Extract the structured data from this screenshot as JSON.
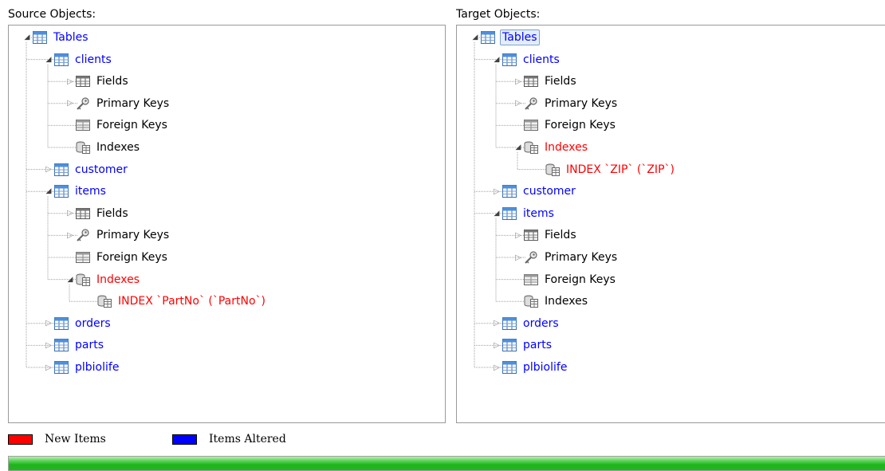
{
  "source": {
    "label": "Source Objects:",
    "rows": [
      {
        "text": "Tables",
        "color": "blue",
        "expander": "expanded",
        "icon": "table",
        "level": 0
      },
      {
        "text": "clients",
        "color": "blue",
        "expander": "expanded",
        "icon": "table",
        "level": 1
      },
      {
        "text": "Fields",
        "color": "black",
        "expander": "collapsed",
        "icon": "fields",
        "level": 2
      },
      {
        "text": "Primary Keys",
        "color": "black",
        "expander": "collapsed",
        "icon": "key",
        "level": 2
      },
      {
        "text": "Foreign Keys",
        "color": "black",
        "expander": "none",
        "icon": "fk",
        "level": 2
      },
      {
        "text": "Indexes",
        "color": "black",
        "expander": "none",
        "icon": "index",
        "level": 2
      },
      {
        "text": "customer",
        "color": "blue",
        "expander": "collapsed",
        "icon": "table",
        "level": 1
      },
      {
        "text": "items",
        "color": "blue",
        "expander": "expanded",
        "icon": "table",
        "level": 1
      },
      {
        "text": "Fields",
        "color": "black",
        "expander": "collapsed",
        "icon": "fields",
        "level": 2
      },
      {
        "text": "Primary Keys",
        "color": "black",
        "expander": "collapsed",
        "icon": "key",
        "level": 2
      },
      {
        "text": "Foreign Keys",
        "color": "black",
        "expander": "none",
        "icon": "fk",
        "level": 2
      },
      {
        "text": "Indexes",
        "color": "red",
        "expander": "expanded",
        "icon": "index",
        "level": 2
      },
      {
        "text": "INDEX `PartNo` (`PartNo`)",
        "color": "red",
        "expander": "none",
        "icon": "index",
        "level": 3
      },
      {
        "text": "orders",
        "color": "blue",
        "expander": "collapsed",
        "icon": "table",
        "level": 1
      },
      {
        "text": "parts",
        "color": "blue",
        "expander": "collapsed",
        "icon": "table",
        "level": 1
      },
      {
        "text": "plbiolife",
        "color": "blue",
        "expander": "collapsed",
        "icon": "table",
        "level": 1
      }
    ]
  },
  "target": {
    "label": "Target Objects:",
    "rows": [
      {
        "text": "Tables",
        "color": "blue",
        "expander": "expanded",
        "icon": "table",
        "level": 0,
        "selected": true
      },
      {
        "text": "clients",
        "color": "blue",
        "expander": "expanded",
        "icon": "table",
        "level": 1
      },
      {
        "text": "Fields",
        "color": "black",
        "expander": "collapsed",
        "icon": "fields",
        "level": 2
      },
      {
        "text": "Primary Keys",
        "color": "black",
        "expander": "collapsed",
        "icon": "key",
        "level": 2
      },
      {
        "text": "Foreign Keys",
        "color": "black",
        "expander": "none",
        "icon": "fk",
        "level": 2
      },
      {
        "text": "Indexes",
        "color": "red",
        "expander": "expanded",
        "icon": "index",
        "level": 2
      },
      {
        "text": "INDEX `ZIP` (`ZIP`)",
        "color": "red",
        "expander": "none",
        "icon": "index",
        "level": 3
      },
      {
        "text": "customer",
        "color": "blue",
        "expander": "collapsed",
        "icon": "table",
        "level": 1
      },
      {
        "text": "items",
        "color": "blue",
        "expander": "expanded",
        "icon": "table",
        "level": 1
      },
      {
        "text": "Fields",
        "color": "black",
        "expander": "collapsed",
        "icon": "fields",
        "level": 2
      },
      {
        "text": "Primary Keys",
        "color": "black",
        "expander": "collapsed",
        "icon": "key",
        "level": 2
      },
      {
        "text": "Foreign Keys",
        "color": "black",
        "expander": "none",
        "icon": "fk",
        "level": 2
      },
      {
        "text": "Indexes",
        "color": "black",
        "expander": "none",
        "icon": "index",
        "level": 2
      },
      {
        "text": "orders",
        "color": "blue",
        "expander": "collapsed",
        "icon": "table",
        "level": 1
      },
      {
        "text": "parts",
        "color": "blue",
        "expander": "collapsed",
        "icon": "table",
        "level": 1
      },
      {
        "text": "plbiolife",
        "color": "blue",
        "expander": "collapsed",
        "icon": "table",
        "level": 1
      }
    ]
  },
  "legend": {
    "new_label": "New Items",
    "new_color": "#ff0000",
    "altered_label": "Items Altered",
    "altered_color": "#0000ff"
  },
  "progress": {
    "percent": 100,
    "color": "#22b525"
  }
}
